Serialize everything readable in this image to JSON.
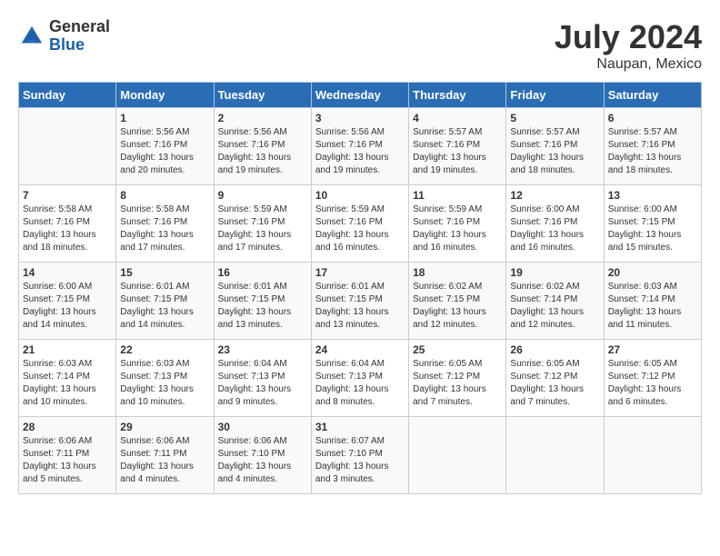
{
  "logo": {
    "general": "General",
    "blue": "Blue"
  },
  "title": "July 2024",
  "subtitle": "Naupan, Mexico",
  "days_header": [
    "Sunday",
    "Monday",
    "Tuesday",
    "Wednesday",
    "Thursday",
    "Friday",
    "Saturday"
  ],
  "weeks": [
    [
      {
        "day": null,
        "data": null
      },
      {
        "day": "1",
        "data": "Sunrise: 5:56 AM\nSunset: 7:16 PM\nDaylight: 13 hours\nand 20 minutes."
      },
      {
        "day": "2",
        "data": "Sunrise: 5:56 AM\nSunset: 7:16 PM\nDaylight: 13 hours\nand 19 minutes."
      },
      {
        "day": "3",
        "data": "Sunrise: 5:56 AM\nSunset: 7:16 PM\nDaylight: 13 hours\nand 19 minutes."
      },
      {
        "day": "4",
        "data": "Sunrise: 5:57 AM\nSunset: 7:16 PM\nDaylight: 13 hours\nand 19 minutes."
      },
      {
        "day": "5",
        "data": "Sunrise: 5:57 AM\nSunset: 7:16 PM\nDaylight: 13 hours\nand 18 minutes."
      },
      {
        "day": "6",
        "data": "Sunrise: 5:57 AM\nSunset: 7:16 PM\nDaylight: 13 hours\nand 18 minutes."
      }
    ],
    [
      {
        "day": "7",
        "data": "Sunrise: 5:58 AM\nSunset: 7:16 PM\nDaylight: 13 hours\nand 18 minutes."
      },
      {
        "day": "8",
        "data": "Sunrise: 5:58 AM\nSunset: 7:16 PM\nDaylight: 13 hours\nand 17 minutes."
      },
      {
        "day": "9",
        "data": "Sunrise: 5:59 AM\nSunset: 7:16 PM\nDaylight: 13 hours\nand 17 minutes."
      },
      {
        "day": "10",
        "data": "Sunrise: 5:59 AM\nSunset: 7:16 PM\nDaylight: 13 hours\nand 16 minutes."
      },
      {
        "day": "11",
        "data": "Sunrise: 5:59 AM\nSunset: 7:16 PM\nDaylight: 13 hours\nand 16 minutes."
      },
      {
        "day": "12",
        "data": "Sunrise: 6:00 AM\nSunset: 7:16 PM\nDaylight: 13 hours\nand 16 minutes."
      },
      {
        "day": "13",
        "data": "Sunrise: 6:00 AM\nSunset: 7:15 PM\nDaylight: 13 hours\nand 15 minutes."
      }
    ],
    [
      {
        "day": "14",
        "data": "Sunrise: 6:00 AM\nSunset: 7:15 PM\nDaylight: 13 hours\nand 14 minutes."
      },
      {
        "day": "15",
        "data": "Sunrise: 6:01 AM\nSunset: 7:15 PM\nDaylight: 13 hours\nand 14 minutes."
      },
      {
        "day": "16",
        "data": "Sunrise: 6:01 AM\nSunset: 7:15 PM\nDaylight: 13 hours\nand 13 minutes."
      },
      {
        "day": "17",
        "data": "Sunrise: 6:01 AM\nSunset: 7:15 PM\nDaylight: 13 hours\nand 13 minutes."
      },
      {
        "day": "18",
        "data": "Sunrise: 6:02 AM\nSunset: 7:15 PM\nDaylight: 13 hours\nand 12 minutes."
      },
      {
        "day": "19",
        "data": "Sunrise: 6:02 AM\nSunset: 7:14 PM\nDaylight: 13 hours\nand 12 minutes."
      },
      {
        "day": "20",
        "data": "Sunrise: 6:03 AM\nSunset: 7:14 PM\nDaylight: 13 hours\nand 11 minutes."
      }
    ],
    [
      {
        "day": "21",
        "data": "Sunrise: 6:03 AM\nSunset: 7:14 PM\nDaylight: 13 hours\nand 10 minutes."
      },
      {
        "day": "22",
        "data": "Sunrise: 6:03 AM\nSunset: 7:13 PM\nDaylight: 13 hours\nand 10 minutes."
      },
      {
        "day": "23",
        "data": "Sunrise: 6:04 AM\nSunset: 7:13 PM\nDaylight: 13 hours\nand 9 minutes."
      },
      {
        "day": "24",
        "data": "Sunrise: 6:04 AM\nSunset: 7:13 PM\nDaylight: 13 hours\nand 8 minutes."
      },
      {
        "day": "25",
        "data": "Sunrise: 6:05 AM\nSunset: 7:12 PM\nDaylight: 13 hours\nand 7 minutes."
      },
      {
        "day": "26",
        "data": "Sunrise: 6:05 AM\nSunset: 7:12 PM\nDaylight: 13 hours\nand 7 minutes."
      },
      {
        "day": "27",
        "data": "Sunrise: 6:05 AM\nSunset: 7:12 PM\nDaylight: 13 hours\nand 6 minutes."
      }
    ],
    [
      {
        "day": "28",
        "data": "Sunrise: 6:06 AM\nSunset: 7:11 PM\nDaylight: 13 hours\nand 5 minutes."
      },
      {
        "day": "29",
        "data": "Sunrise: 6:06 AM\nSunset: 7:11 PM\nDaylight: 13 hours\nand 4 minutes."
      },
      {
        "day": "30",
        "data": "Sunrise: 6:06 AM\nSunset: 7:10 PM\nDaylight: 13 hours\nand 4 minutes."
      },
      {
        "day": "31",
        "data": "Sunrise: 6:07 AM\nSunset: 7:10 PM\nDaylight: 13 hours\nand 3 minutes."
      },
      {
        "day": null,
        "data": null
      },
      {
        "day": null,
        "data": null
      },
      {
        "day": null,
        "data": null
      }
    ]
  ]
}
